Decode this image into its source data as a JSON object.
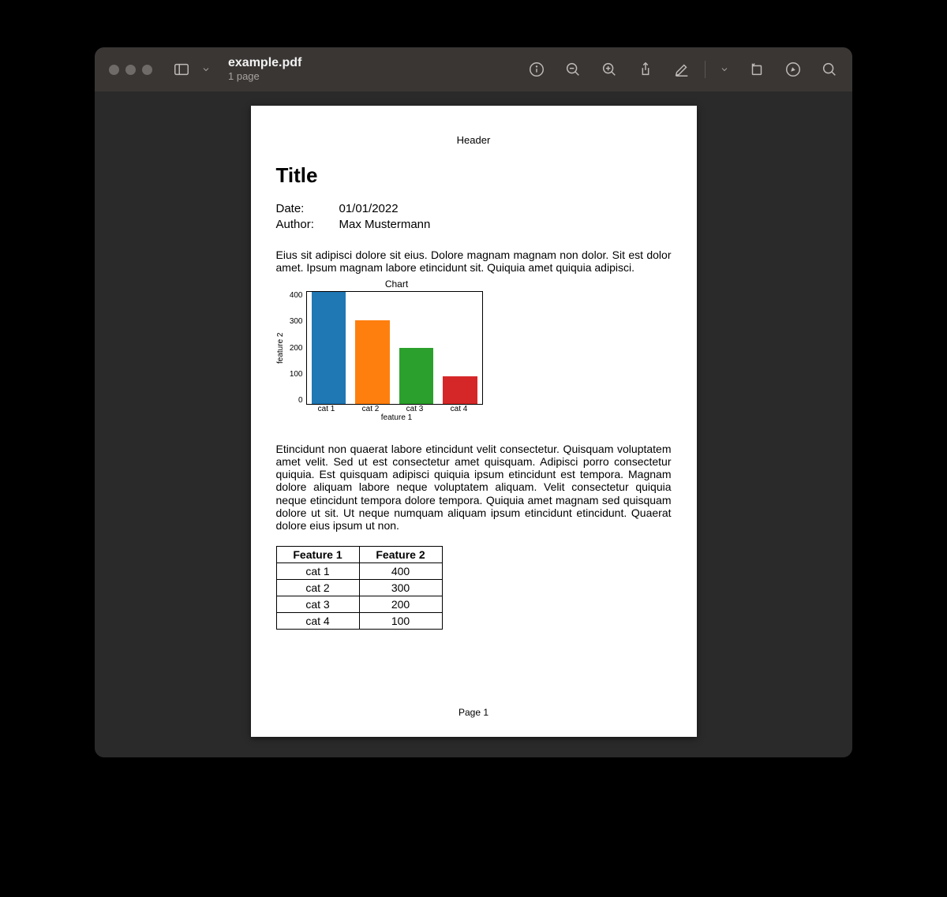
{
  "window": {
    "filename": "example.pdf",
    "page_count_label": "1 page"
  },
  "doc": {
    "header": "Header",
    "title": "Title",
    "date_label": "Date:",
    "date_value": "01/01/2022",
    "author_label": "Author:",
    "author_value": "Max Mustermann",
    "para1": "Eius sit adipisci dolore sit eius. Dolore magnam magnam non dolor. Sit est dolor amet. Ipsum magnam labore etincidunt sit. Quiquia amet quiquia adipisci.",
    "para2": "Etincidunt non quaerat labore etincidunt velit consectetur. Quisquam voluptatem amet velit. Sed ut est consectetur amet quisquam. Adipisci porro consectetur quiquia. Est quisquam adipisci quiquia ipsum etincidunt est tempora. Magnam dolore aliquam labore neque voluptatem aliquam. Velit consectetur quiquia neque etincidunt tempora dolore tempora. Quiquia amet magnam sed quisquam dolore ut sit. Ut neque numquam aliquam ipsum etincidunt etincidunt. Quaerat dolore eius ipsum ut non.",
    "footer": "Page 1"
  },
  "chart_data": {
    "type": "bar",
    "title": "Chart",
    "xlabel": "feature 1",
    "ylabel": "feature 2",
    "categories": [
      "cat 1",
      "cat 2",
      "cat 3",
      "cat 4"
    ],
    "values": [
      400,
      300,
      200,
      100
    ],
    "colors": [
      "#1f77b4",
      "#ff7f0e",
      "#2ca02c",
      "#d62728"
    ],
    "ylim": [
      0,
      400
    ],
    "yticks": [
      0,
      100,
      200,
      300,
      400
    ]
  },
  "table": {
    "headers": [
      "Feature 1",
      "Feature 2"
    ],
    "rows": [
      [
        "cat 1",
        "400"
      ],
      [
        "cat 2",
        "300"
      ],
      [
        "cat 3",
        "200"
      ],
      [
        "cat 4",
        "100"
      ]
    ]
  }
}
